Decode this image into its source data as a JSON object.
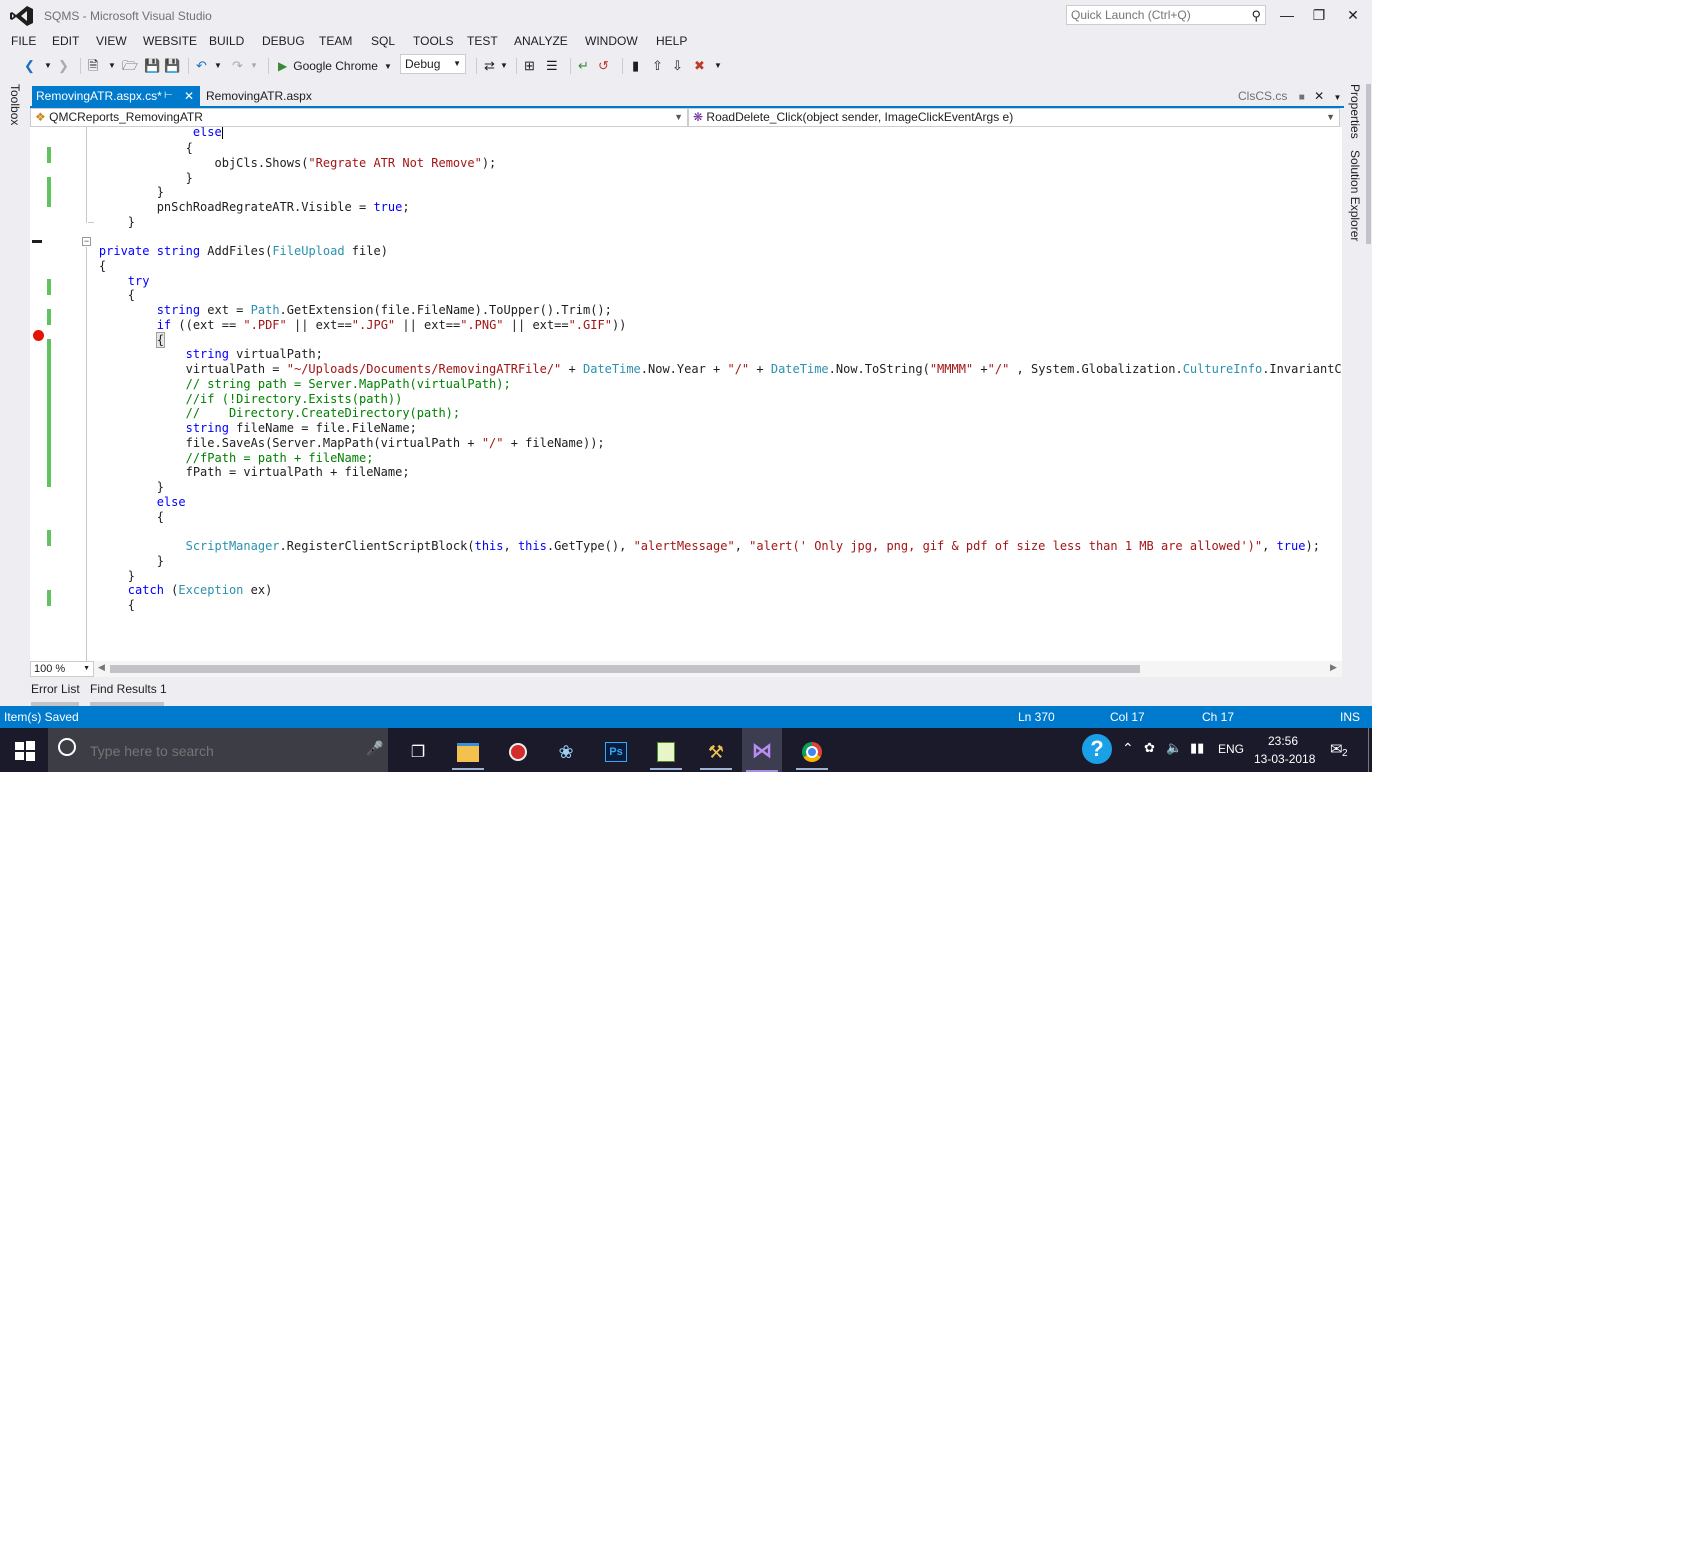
{
  "window": {
    "title": "SQMS - Microsoft Visual Studio"
  },
  "quick_launch": {
    "placeholder": "Quick Launch (Ctrl+Q)"
  },
  "menu": [
    "FILE",
    "EDIT",
    "VIEW",
    "WEBSITE",
    "BUILD",
    "DEBUG",
    "TEAM",
    "SQL",
    "TOOLS",
    "TEST",
    "ANALYZE",
    "WINDOW",
    "HELP"
  ],
  "toolbar": {
    "run_target": "Google Chrome",
    "configuration": "Debug"
  },
  "side_panels": {
    "left": "Toolbox",
    "right": [
      "Properties",
      "Solution Explorer"
    ]
  },
  "tabs": [
    {
      "label": "RemovingATR.aspx.cs*",
      "active": true
    },
    {
      "label": "RemovingATR.aspx",
      "active": false
    },
    {
      "label": "ClsCS.cs",
      "active": false
    }
  ],
  "nav": {
    "class": "QMCReports_RemovingATR",
    "member": "RoadDelete_Click(object sender, ImageClickEventArgs e)"
  },
  "editor": {
    "zoom": "100 %"
  },
  "bottom_tabs": [
    "Error List",
    "Find Results 1"
  ],
  "status": {
    "message": "Item(s) Saved",
    "ln": "Ln 370",
    "col": "Col 17",
    "ch": "Ch 17",
    "mode": "INS"
  },
  "taskbar": {
    "search_placeholder": "Type here to search",
    "language": "ENG",
    "time": "23:56",
    "date": "13-03-2018",
    "notifications": "2"
  },
  "colors": {
    "accent": "#007acc",
    "keyword": "#0000ff",
    "type": "#2b91af",
    "string": "#a31515",
    "comment": "#008000",
    "changed": "#5fc35f",
    "breakpoint": "#e51400"
  }
}
